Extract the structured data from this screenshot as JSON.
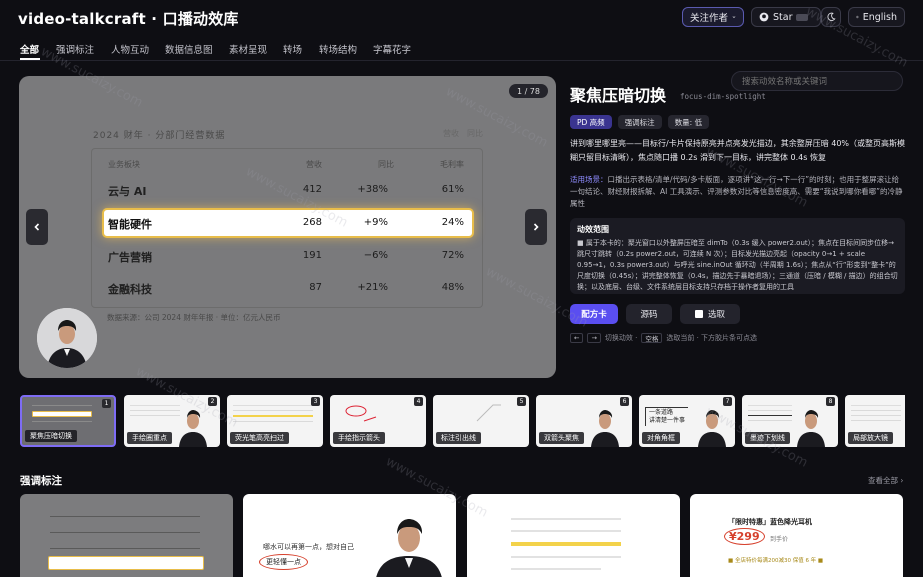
{
  "header": {
    "brand": "video-talkcraft · 口播动效库",
    "follow_label": "关注作者",
    "star_label": "Star",
    "lang_label": "English"
  },
  "tabs": [
    "全部",
    "强调标注",
    "人物互动",
    "数据信息图",
    "素材呈现",
    "转场",
    "转场结构",
    "字幕花字"
  ],
  "search": {
    "placeholder": "搜索动效名称或关键词"
  },
  "stage": {
    "counter": "1 / 78",
    "table_title": "2024 财年 · 分部门经营数据",
    "legend": [
      "营收",
      "同比"
    ],
    "headers": [
      "业务板块",
      "营收",
      "同比",
      "毛利率"
    ],
    "rows": [
      [
        "云与 AI",
        "412",
        "+38%",
        "61%"
      ],
      [
        "智能硬件",
        "268",
        "+9%",
        "24%"
      ],
      [
        "广告营销",
        "191",
        "−6%",
        "72%"
      ],
      [
        "金融科技",
        "87",
        "+21%",
        "48%"
      ]
    ],
    "source": "数据来源：公司 2024 财年年报 · 单位：亿元人民币"
  },
  "effect": {
    "title": "聚焦压暗切换",
    "code": "focus-dim-spotlight",
    "tags": [
      "PD 高频",
      "强调标注",
      "数量: 低"
    ],
    "description": "讲到哪里哪里亮——目标行/卡片保持原亮并点亮发光描边，其余整屏压暗 40%（或整页高斯模糊只留目标清晰），焦点随口播 0.2s 滑到下一目标，讲完整体 0.4s 恢复",
    "scene_label": "适用场景：",
    "scene_text": "口播出示表格/清单/代码/多卡版面，逐项讲“这一行→下一行”的时刻；也用于整屏滚让给一句结论、财经财报拆解、AI 工具演示、评测参数对比等信息密度高、需要“我说到哪你看哪”的冷静属性",
    "spec_title": "动效范围",
    "spec_text": "■ 属于本卡的：聚光窗口以外整屏压暗至 dimTo（0.3s 缓入 power2.out）；焦点在目标间同步位移→跳尺寸跳转（0.2s power2.out，可连续 N 次）；目标发光描边亮起（opacity 0→1 + scale 0.95→1，0.3s power3.out）与呼光 sine.inOut 循环动（半周期 1.6s）；焦点从“行”形变到“整卡”的尺度切换（0.45s）；讲完整体恢复（0.4s，描边先于暴暗退场）；三通道（压暗 / 模糊 / 描边）的组合切换；以及底层、台级、文件系统层目标支持只存档于操作者复用的工具",
    "btn_primary": "配方卡",
    "btn_source": "源码",
    "btn_select": "选取",
    "hint_prefix": "切换动效 ·",
    "hint_key": "空格",
    "hint_suffix": "选取当前 · 下方胶片条可点选"
  },
  "thumbs": [
    {
      "num": "1",
      "cap": "聚焦压暗切换"
    },
    {
      "num": "2",
      "cap": "手绘圈重点"
    },
    {
      "num": "3",
      "cap": "荧光笔高亮扫过"
    },
    {
      "num": "4",
      "cap": "手绘指示箭头"
    },
    {
      "num": "5",
      "cap": "标注引出线"
    },
    {
      "num": "6",
      "cap": "双箭头聚焦"
    },
    {
      "num": "7",
      "cap": "对角角框"
    },
    {
      "num": "8",
      "cap": "墨迹下划线"
    },
    {
      "num": "9",
      "cap": "局部放大镜"
    }
  ],
  "thumb_quotes": {
    "t7_line1": "一条道路",
    "t7_line2": "讲清楚一件事"
  },
  "section": {
    "title": "强调标注",
    "see_all": "查看全部 ›"
  },
  "cards": {
    "c2_line1": "哪水可以再第一点，想对自己",
    "c2_circle": "更轻懂一点",
    "c4_title": "「限时特惠」蓝色降光耳机",
    "c4_price": "¥299",
    "c4_meta": "到手价",
    "c4_note": "■ 全店特价每满200减30 保值 6 年 ■"
  },
  "watermark": "www.sucaizy.com",
  "colors": {
    "accent": "#5a4ef0",
    "highlight_border": "#e8bd4a",
    "thumb_selected": "#7e6cf5"
  }
}
